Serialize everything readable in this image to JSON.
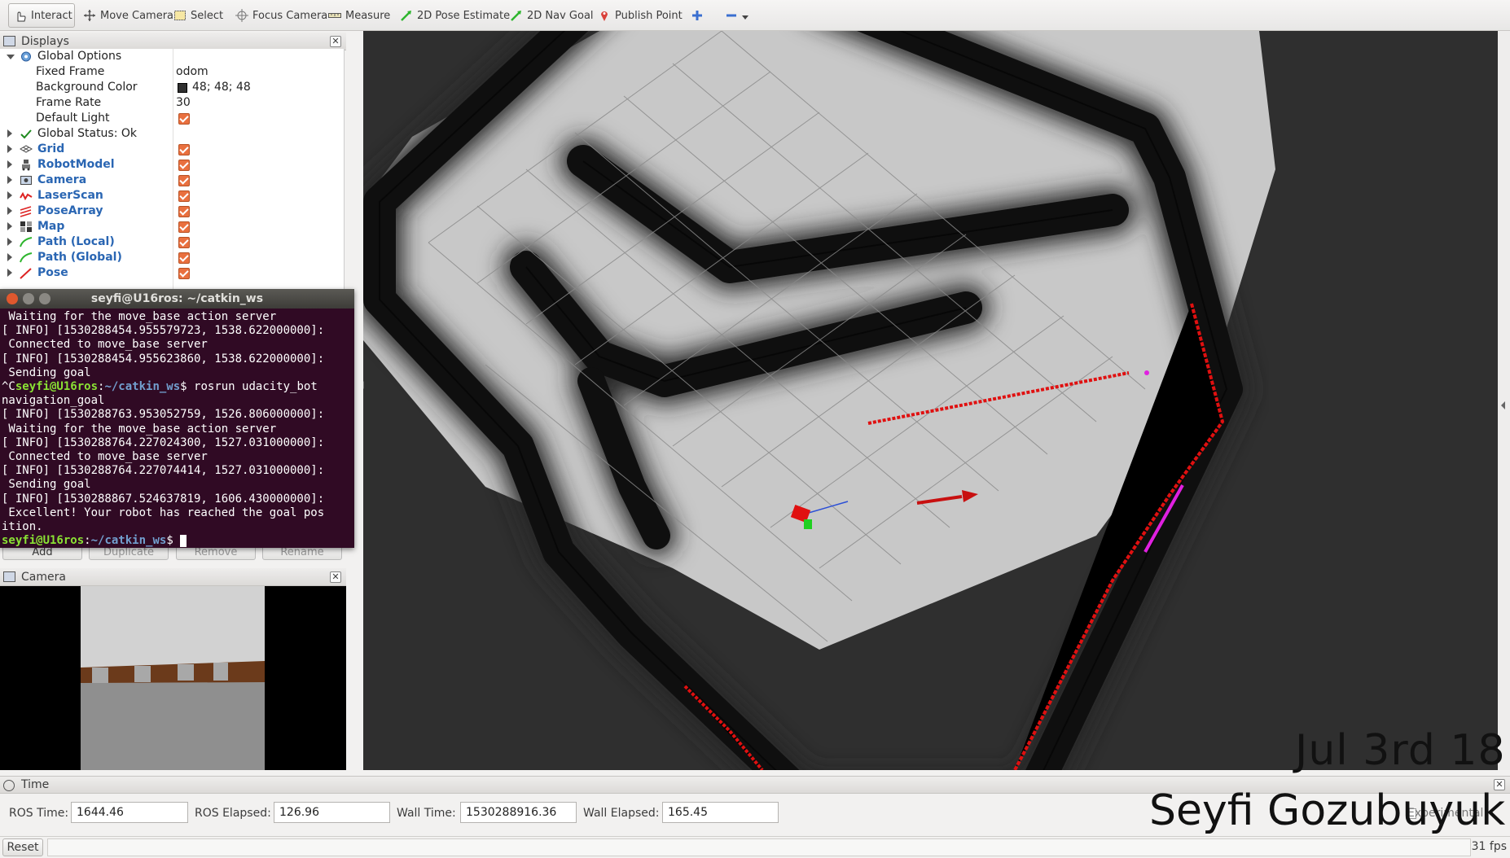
{
  "toolbar": {
    "tools": [
      "Interact",
      "Move Camera",
      "Select",
      "Focus Camera",
      "Measure",
      "2D Pose Estimate",
      "2D Nav Goal",
      "Publish Point"
    ]
  },
  "displays_panel": {
    "title": "Displays",
    "global_options": {
      "label": "Global Options",
      "fixed_frame_label": "Fixed Frame",
      "fixed_frame_value": "odom",
      "bg_color_label": "Background Color",
      "bg_color_value": "48; 48; 48",
      "frame_rate_label": "Frame Rate",
      "frame_rate_value": "30",
      "default_light_label": "Default Light"
    },
    "global_status": "Global Status: Ok",
    "items": [
      {
        "label": "Grid",
        "icon": "grid-icon"
      },
      {
        "label": "RobotModel",
        "icon": "robot-icon"
      },
      {
        "label": "Camera",
        "icon": "camera-icon"
      },
      {
        "label": "LaserScan",
        "icon": "laserscan-icon"
      },
      {
        "label": "PoseArray",
        "icon": "posearray-icon"
      },
      {
        "label": "Map",
        "icon": "map-icon"
      },
      {
        "label": "Path (Local)",
        "icon": "path-icon"
      },
      {
        "label": "Path (Global)",
        "icon": "path-icon"
      },
      {
        "label": "Pose",
        "icon": "pose-icon"
      }
    ],
    "buttons": {
      "add": "Add",
      "duplicate": "Duplicate",
      "remove": "Remove",
      "rename": "Rename"
    }
  },
  "terminal": {
    "title": "seyfi@U16ros: ~/catkin_ws",
    "lines": [
      " Waiting for the move_base action server",
      "[ INFO] [1530288454.955579723, 1538.622000000]:",
      " Connected to move_base server",
      "[ INFO] [1530288454.955623860, 1538.622000000]:",
      " Sending goal"
    ],
    "cmd_prefix": "^C",
    "prompt_user": "seyfi@U16ros",
    "prompt_dir": "~/catkin_ws",
    "command": "$ rosrun udacity_bot",
    "command_cont": "navigation_goal",
    "lines2": [
      "[ INFO] [1530288763.953052759, 1526.806000000]:",
      " Waiting for the move_base action server",
      "[ INFO] [1530288764.227024300, 1527.031000000]:",
      " Connected to move_base server",
      "[ INFO] [1530288764.227074414, 1527.031000000]:",
      " Sending goal",
      "[ INFO] [1530288867.524637819, 1606.430000000]:",
      " Excellent! Your robot has reached the goal pos",
      "ition."
    ],
    "prompt_end": "$ "
  },
  "camera_panel": {
    "title": "Camera"
  },
  "time_panel": {
    "title": "Time",
    "ros_time_label": "ROS Time:",
    "ros_time": "1644.46",
    "ros_elapsed_label": "ROS Elapsed:",
    "ros_elapsed": "126.96",
    "wall_time_label": "Wall Time:",
    "wall_time": "1530288916.36",
    "wall_elapsed_label": "Wall Elapsed:",
    "wall_elapsed": "165.45",
    "experimental_label": "Experimental"
  },
  "status": {
    "reset": "Reset",
    "fps": "31 fps"
  },
  "overlay": {
    "date": "Jul 3rd 18",
    "author": "Seyfi Gozubuyuk"
  }
}
